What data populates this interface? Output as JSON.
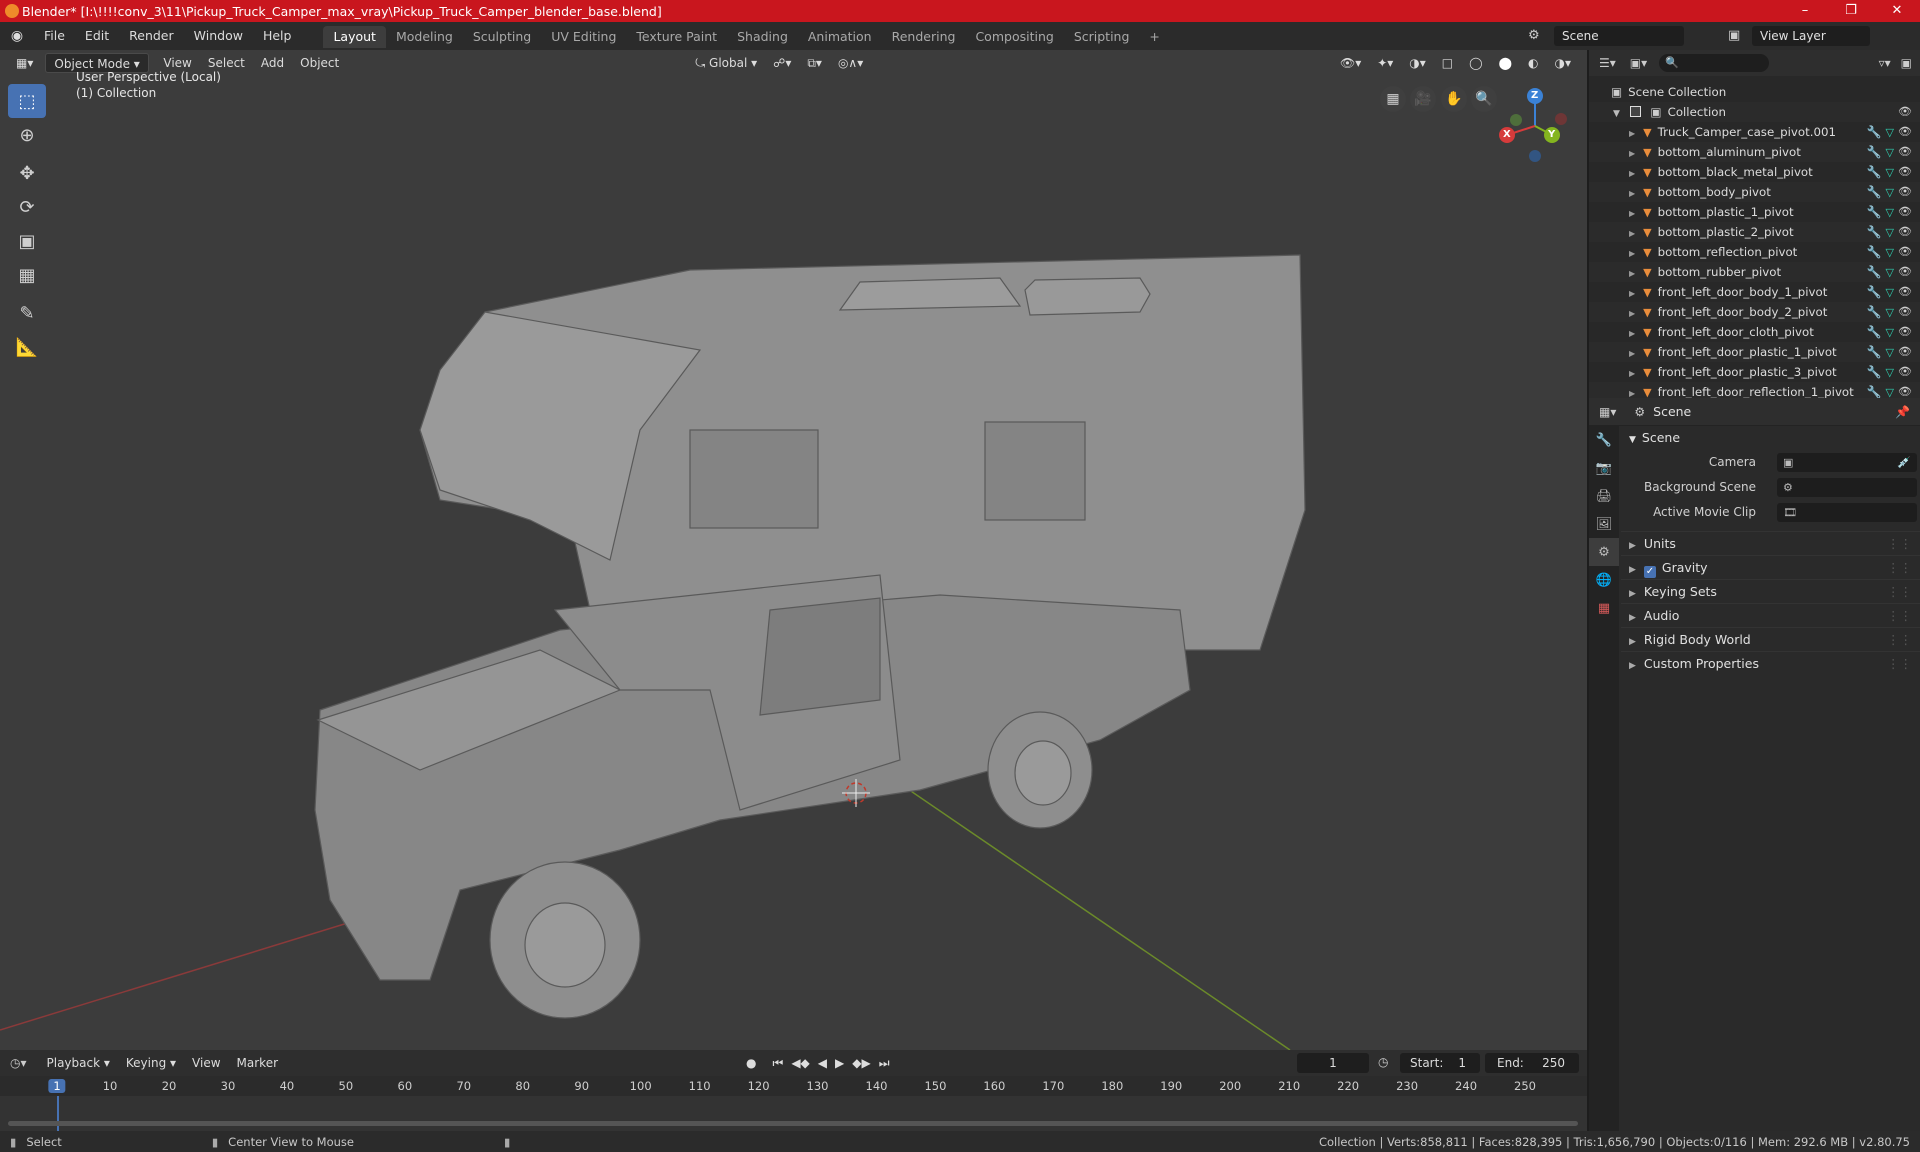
{
  "window": {
    "title": "Blender* [I:\\!!!!conv_3\\11\\Pickup_Truck_Camper_max_vray\\Pickup_Truck_Camper_blender_base.blend]",
    "minimize": "–",
    "maximize": "❐",
    "close": "✕"
  },
  "menu": {
    "items": [
      "File",
      "Edit",
      "Render",
      "Window",
      "Help"
    ],
    "workspaces": [
      "Layout",
      "Modeling",
      "Sculpting",
      "UV Editing",
      "Texture Paint",
      "Shading",
      "Animation",
      "Rendering",
      "Compositing",
      "Scripting"
    ],
    "add_tab": "+",
    "scene_name": "Scene",
    "view_layer": "View Layer"
  },
  "viewport": {
    "mode": "Object Mode",
    "menus": [
      "View",
      "Select",
      "Add",
      "Object"
    ],
    "transform_orientation": "Global",
    "perspective_label": "User Perspective (Local)",
    "collection_label": "(1) Collection",
    "gizmo_axes": {
      "x": "X",
      "y": "Y",
      "z": "Z"
    }
  },
  "outliner": {
    "root": "Scene Collection",
    "collection": "Collection",
    "objects": [
      "Truck_Camper_case_pivot.001",
      "bottom_aluminum_pivot",
      "bottom_black_metal_pivot",
      "bottom_body_pivot",
      "bottom_plastic_1_pivot",
      "bottom_plastic_2_pivot",
      "bottom_reflection_pivot",
      "bottom_rubber_pivot",
      "front_left_door_body_1_pivot",
      "front_left_door_body_2_pivot",
      "front_left_door_cloth_pivot",
      "front_left_door_plastic_1_pivot",
      "front_left_door_plastic_3_pivot",
      "front_left_door_reflection_1_pivot"
    ]
  },
  "properties": {
    "header": "Scene",
    "panel": "Scene",
    "fields": [
      {
        "label": "Camera"
      },
      {
        "label": "Background Scene"
      },
      {
        "label": "Active Movie Clip"
      }
    ],
    "subpanels": [
      "Units",
      "Gravity",
      "Keying Sets",
      "Audio",
      "Rigid Body World",
      "Custom Properties"
    ]
  },
  "timeline": {
    "menus": [
      "Playback",
      "Keying",
      "View",
      "Marker"
    ],
    "current_frame": "1",
    "start_label": "Start:",
    "start": "1",
    "end_label": "End:",
    "end": "250",
    "ruler": [
      "1",
      "10",
      "20",
      "30",
      "40",
      "50",
      "60",
      "70",
      "80",
      "90",
      "100",
      "110",
      "120",
      "130",
      "140",
      "150",
      "160",
      "170",
      "180",
      "190",
      "200",
      "210",
      "220",
      "230",
      "240",
      "250"
    ]
  },
  "status": {
    "left_action": "Select",
    "middle_action": "Center View to Mouse",
    "stats": "Collection | Verts:858,811 | Faces:828,395 | Tris:1,656,790 | Objects:0/116 | Mem: 292.6 MB | v2.80.75"
  },
  "colors": {
    "titlebar": "#c9161e",
    "accent": "#4772b3",
    "object_icon": "#e98d3c",
    "mesh_icon": "#2fd4b4"
  }
}
